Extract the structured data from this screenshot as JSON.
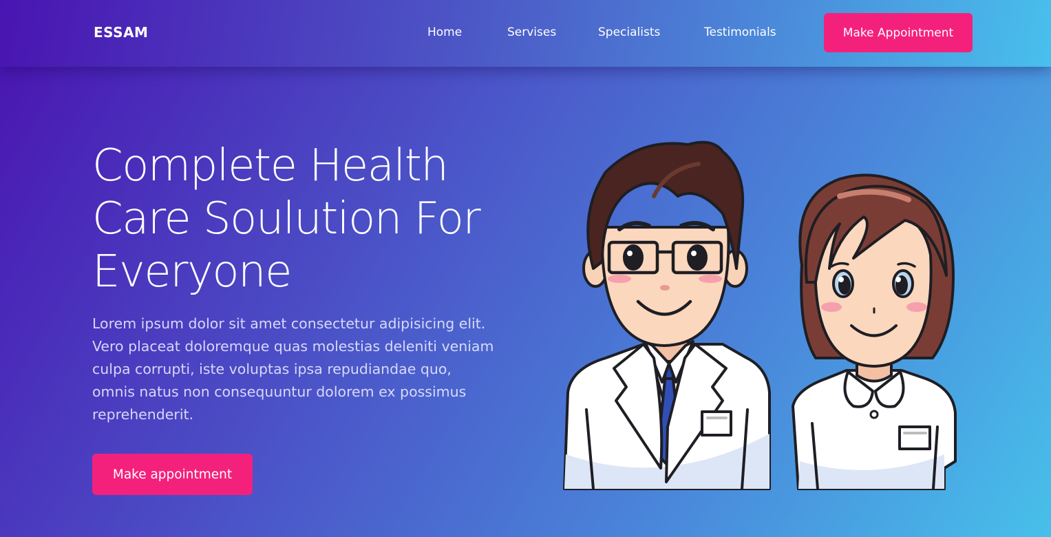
{
  "navbar": {
    "brand": "ESSAM",
    "links": [
      {
        "label": "Home"
      },
      {
        "label": "Servises"
      },
      {
        "label": "Specialists"
      },
      {
        "label": "Testimonials"
      }
    ],
    "cta_label": "Make Appointment"
  },
  "hero": {
    "title_lines": [
      "Complete Health",
      "Care Soulution For",
      "Everyone"
    ],
    "description": "Lorem ipsum dolor sit amet consectetur adipisicing elit. Vero placeat doloremque quas molestias deleniti veniam culpa corrupti, iste voluptas ipsa repudiandae quo, omnis natus non consequuntur dolorem ex possimus reprehenderit.",
    "cta_label": "Make appointment"
  },
  "colors": {
    "accent": "#f4217c",
    "gradient_start": "#4a12b0",
    "gradient_end": "#47c0ea"
  },
  "illustration": {
    "icon": "doctor-and-nurse-illustration"
  }
}
